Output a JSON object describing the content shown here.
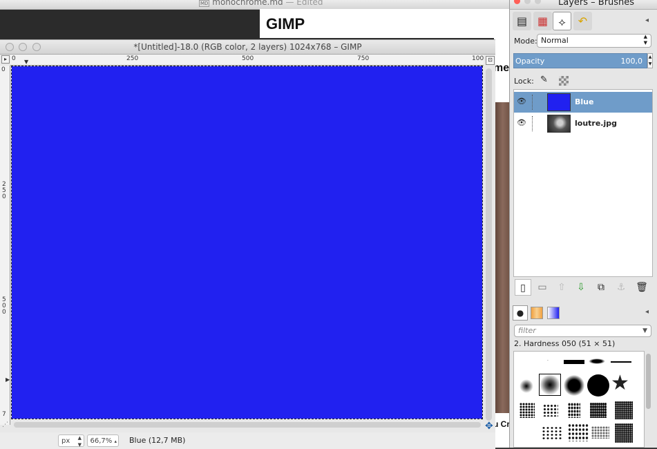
{
  "background_editor": {
    "title": "monochrome.md",
    "status": "— Edited",
    "heading": "GIMP",
    "side_fragment": "me",
    "bottom_fragment": "u Cr"
  },
  "image_window": {
    "title": "*[Untitled]-18.0 (RGB color, 2 layers) 1024x768 – GIMP",
    "ruler_top_ticks": [
      "0",
      "250",
      "500",
      "750",
      "100"
    ],
    "ruler_left_ticks": [
      "0",
      "2\n5\n0",
      "5\n0\n0",
      "7"
    ],
    "canvas_color": "#2121f0",
    "statusbar": {
      "unit": "px",
      "zoom": "66,7%",
      "layer_info": "Blue  (12,7 MB)"
    }
  },
  "layers_dock": {
    "title": "Layers – Brushes",
    "mode_label": "Mode:",
    "mode_value": "Normal",
    "opacity_label": "Opacity",
    "opacity_value": "100,0",
    "lock_label": "Lock:",
    "layers": [
      {
        "name": "Blue",
        "selected": true,
        "thumb_color": "#2121f0"
      },
      {
        "name": "loutre.jpg",
        "selected": false,
        "thumb_color": "#3a3a3a"
      }
    ],
    "brushes": {
      "filter_placeholder": "filter",
      "selected_brush": "2. Hardness 050 (51 × 51)"
    }
  }
}
